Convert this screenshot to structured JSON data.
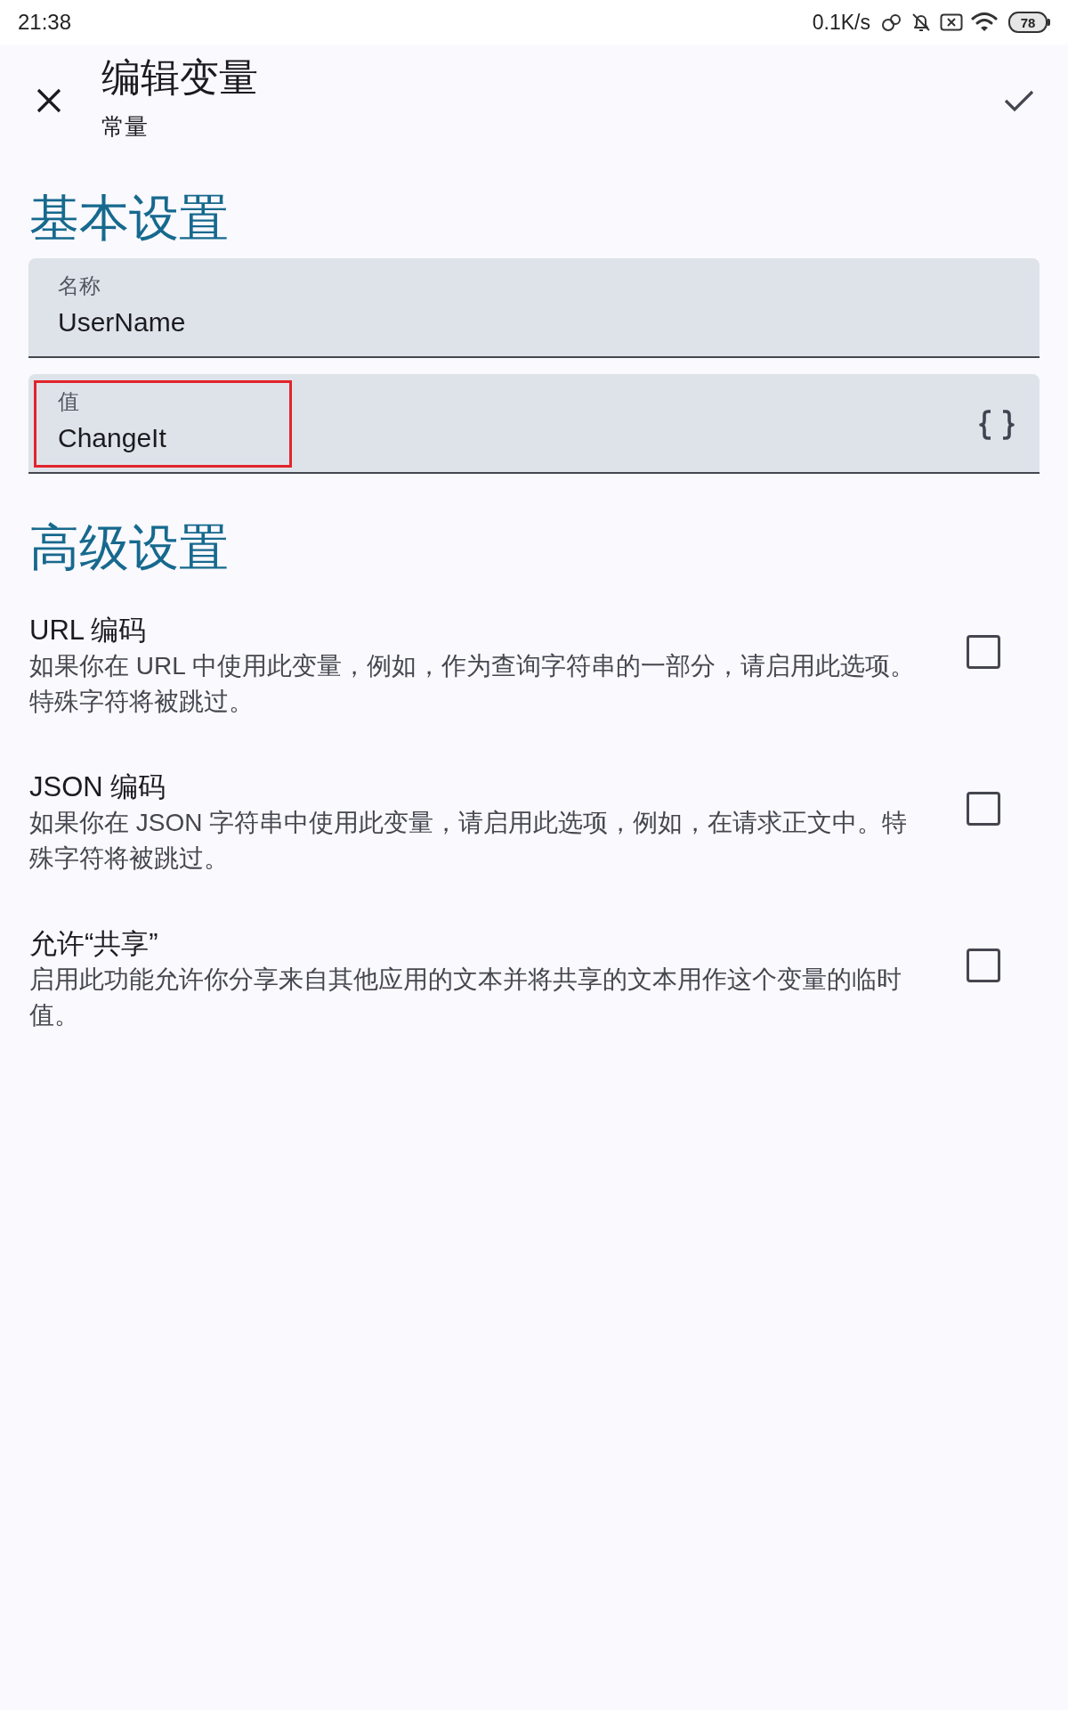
{
  "status_bar": {
    "time": "21:38",
    "network_speed": "0.1K/s",
    "battery": "78"
  },
  "header": {
    "title": "编辑变量",
    "subtitle": "常量"
  },
  "basic_settings": {
    "heading": "基本设置",
    "fields": [
      {
        "label": "名称",
        "value": "UserName",
        "highlighted": false,
        "braces_button": false
      },
      {
        "label": "值",
        "value": "ChangeIt",
        "highlighted": true,
        "braces_button": true
      }
    ]
  },
  "advanced_settings": {
    "heading": "高级设置",
    "options": [
      {
        "title": "URL 编码",
        "description": [
          "如果你在 URL 中使用此变量，例如，作为查询字符串的一部分，请启用此选项。",
          "特殊字符将被跳过。"
        ],
        "checked": false
      },
      {
        "title": "JSON 编码",
        "description": [
          "如果你在 JSON 字符串中使用此变量，请启用此选项，例如，在请求正文中。特殊字符将被跳过。"
        ],
        "checked": false
      },
      {
        "title": "允许“共享”",
        "description": [
          "启用此功能允许你分享来自其他应用的文本并将共享的文本用作这个变量的临时值。"
        ],
        "checked": false
      }
    ]
  }
}
